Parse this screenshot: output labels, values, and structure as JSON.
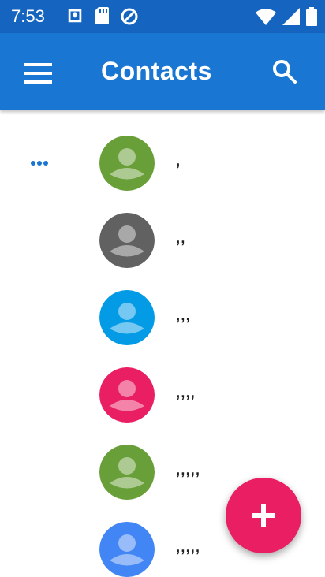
{
  "status_bar": {
    "time": "7:53",
    "left_icons": [
      "maps-icon",
      "sd-card-icon",
      "data-saver-icon"
    ],
    "right_icons": [
      "wifi-icon",
      "signal-icon",
      "battery-icon"
    ]
  },
  "app_bar": {
    "title": "Contacts",
    "menu_icon": "hamburger-menu-icon",
    "search_icon": "search-icon",
    "color": "#1976d2",
    "status_color": "#1565c0"
  },
  "contacts": [
    {
      "name": ",",
      "avatar_color": "#689f38"
    },
    {
      "name": ",,",
      "avatar_color": "#616161"
    },
    {
      "name": ",,,",
      "avatar_color": "#039be5"
    },
    {
      "name": ",,,,",
      "avatar_color": "#e91e63"
    },
    {
      "name": ",,,,,",
      "avatar_color": "#689f38"
    },
    {
      "name": ",,,,,",
      "avatar_color": "#4285f4"
    }
  ],
  "fab": {
    "icon": "add-icon",
    "color": "#e91e63"
  }
}
